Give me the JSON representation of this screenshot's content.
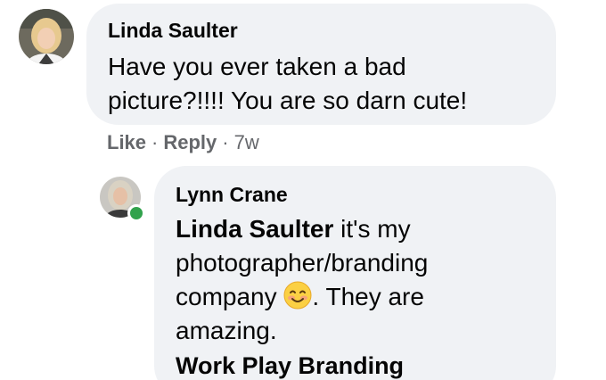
{
  "comments": [
    {
      "author": "Linda Saulter",
      "text": "Have you ever taken a bad picture?!!!! You are so darn cute!",
      "actions": {
        "like": "Like",
        "reply": "Reply",
        "time": "7w"
      }
    }
  ],
  "reply": {
    "author": "Lynn Crane",
    "mention": "Linda Saulter",
    "text_line1": " it's my",
    "text_line2": "photographer/branding",
    "text_line3_prefix": "company ",
    "emoji": "smiling-face-icon",
    "text_line3_suffix": ". They are",
    "text_line4": "amazing.",
    "link_title": "Work Play Branding"
  },
  "colors": {
    "bubble": "#f0f2f5",
    "meta_text": "#65676b",
    "online": "#31a24c"
  }
}
